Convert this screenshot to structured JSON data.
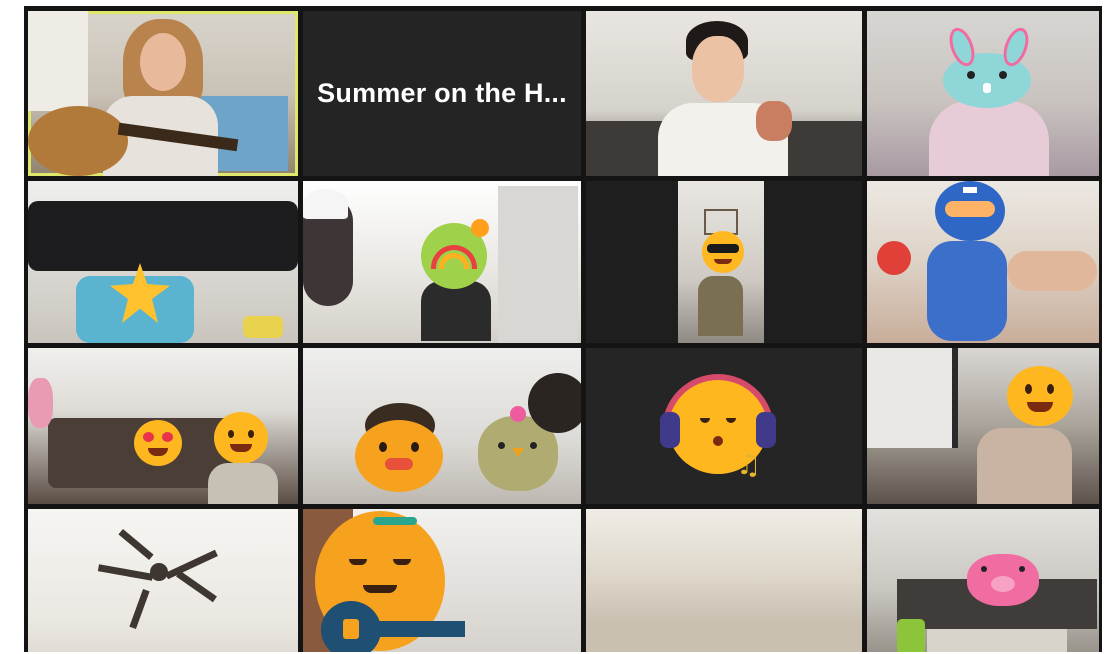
{
  "meeting": {
    "title_tile_text": "Summer on the H...",
    "active_speaker_color": "#dfe86a",
    "background_color": "#141414"
  },
  "tiles": [
    {
      "id": "guitar-singer",
      "avatar": "none"
    },
    {
      "id": "name-only",
      "avatar": "none"
    },
    {
      "id": "man-singing",
      "avatar": "none"
    },
    {
      "id": "bunny-filter",
      "avatar": "bunny-mask-icon"
    },
    {
      "id": "star-filter",
      "avatar": "star-face-icon"
    },
    {
      "id": "rainbow-filter",
      "avatar": "rainbow-face-icon"
    },
    {
      "id": "sunglasses-filter",
      "avatar": "sunglasses-face-icon"
    },
    {
      "id": "ninja-filter",
      "avatar": "ninja-face-icon"
    },
    {
      "id": "two-faces",
      "avatar": "heart-eyes-face-icon"
    },
    {
      "id": "duck-chick",
      "avatar": "duck-face-icon"
    },
    {
      "id": "headphones-filter",
      "avatar": "headphones-face-icon"
    },
    {
      "id": "smile-filter",
      "avatar": "smiling-face-icon"
    },
    {
      "id": "ceiling-fan",
      "avatar": "none"
    },
    {
      "id": "guitar-face",
      "avatar": "guitar-face-icon"
    },
    {
      "id": "ceiling",
      "avatar": "none"
    },
    {
      "id": "pig-filter",
      "avatar": "pig-mask-icon"
    }
  ]
}
